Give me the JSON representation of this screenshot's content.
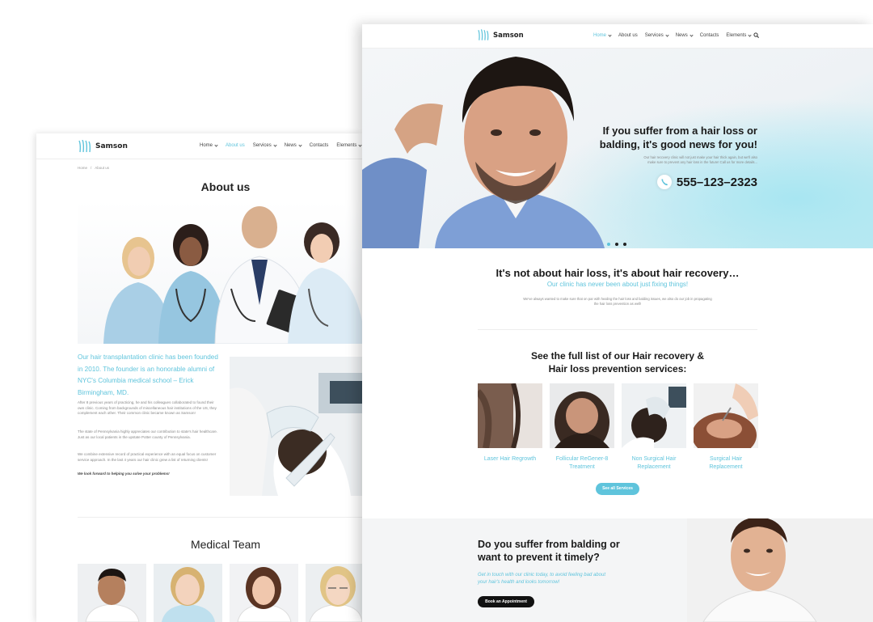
{
  "left_page": {
    "logo": "Samson",
    "menu": [
      {
        "label": "Home",
        "caret": true,
        "active": false
      },
      {
        "label": "About us",
        "caret": false,
        "active": true
      },
      {
        "label": "Services",
        "caret": true,
        "active": false
      },
      {
        "label": "News",
        "caret": true,
        "active": false
      },
      {
        "label": "Contacts",
        "caret": false,
        "active": false
      },
      {
        "label": "Elements",
        "caret": true,
        "active": false
      }
    ],
    "breadcrumb": {
      "home": "Home",
      "separator": "/",
      "current": "About us"
    },
    "title": "About us",
    "intro": "Our hair transplantation clinic has been founded in 2010. The founder is an honorable alumni of NYC's Columbia medical school – Erick Birmingham, MD.",
    "para1": "After 8 previous years of practicing, he and his colleagues collaborated to found their own clinic. Coming from backgrounds of miscellaneous hair institutions of the US, they complement each other. Their common clinic became known as Samson!",
    "para2": "The state of Pennsylvania highly appreciates our contribution to state's hair healthcare. Just as our local patients in the upstate Potter county of Pennsylvania.",
    "para3": "We combine extensive record of practical experience with an equal focus on customer service approach. In the last 4 years our hair clinic grew a list of returning clients!",
    "closing": "We look forward to helping you solve your problems!",
    "team_title": "Medical Team"
  },
  "right_page": {
    "logo": "Samson",
    "menu": [
      {
        "label": "Home",
        "caret": true,
        "active": true
      },
      {
        "label": "About us",
        "caret": false,
        "active": false
      },
      {
        "label": "Services",
        "caret": true,
        "active": false
      },
      {
        "label": "News",
        "caret": true,
        "active": false
      },
      {
        "label": "Contacts",
        "caret": false,
        "active": false
      },
      {
        "label": "Elements",
        "caret": true,
        "active": false
      }
    ],
    "hero": {
      "heading_line1": "If you suffer from a hair loss or",
      "heading_line2": "balding, it's good news for you!",
      "text_line1": "Our hair recovery clinic will not just make your hair thick again, but we'll also",
      "text_line2": "make sure to prevent any hair loss in the future! Call us for more details...",
      "phone": "555–123–2323",
      "active_slide": 1,
      "slide_count": 3
    },
    "intro": {
      "heading": "It's not about hair loss, it's about hair recovery…",
      "subheading": "Our clinic has never been about just fixing things!",
      "text_line1": "We've always wanted to make sure that on par with healing the hair loss and balding issues, we also do our job in propagating",
      "text_line2": "the hair loss prevention as well!"
    },
    "services": {
      "heading_line1": "See the full list of our Hair recovery &",
      "heading_line2": "Hair loss prevention services:",
      "items": [
        {
          "line1": "Laser Hair Regrowth",
          "line2": ""
        },
        {
          "line1": "Follicular ReGener-8",
          "line2": "Treatment"
        },
        {
          "line1": "Non Surgical Hair",
          "line2": "Replacement"
        },
        {
          "line1": "Surgical Hair",
          "line2": "Replacement"
        }
      ],
      "button": "See all Services"
    },
    "cta": {
      "heading_line1": "Do you suffer from balding or",
      "heading_line2": "want to prevent it timely?",
      "text_line1": "Get in touch with our clinic today, to avoid feeling bad about",
      "text_line2": "your hair's health and looks tomorrow!",
      "button": "Book an Appointment"
    }
  },
  "colors": {
    "accent": "#5fc4dc",
    "dark": "#111111",
    "text": "#222222"
  }
}
